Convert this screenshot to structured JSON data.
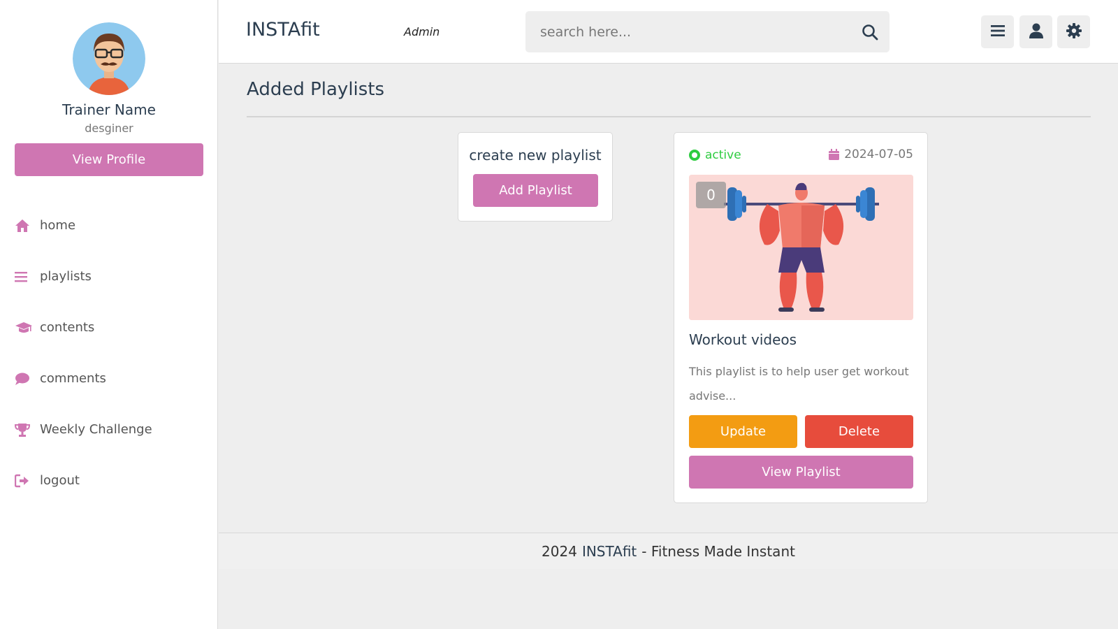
{
  "header": {
    "logo": "INSTAfit",
    "role": "Admin",
    "search_placeholder": "search here..."
  },
  "profile": {
    "name": "Trainer Name",
    "role": "desginer",
    "view_profile_label": "View Profile"
  },
  "nav": {
    "items": [
      {
        "label": "home",
        "icon": "home-icon"
      },
      {
        "label": "playlists",
        "icon": "list-icon"
      },
      {
        "label": "contents",
        "icon": "graduation-cap-icon"
      },
      {
        "label": "comments",
        "icon": "comment-icon"
      },
      {
        "label": "Weekly Challenge",
        "icon": "trophy-icon"
      },
      {
        "label": "logout",
        "icon": "logout-icon"
      }
    ]
  },
  "main": {
    "title": "Added Playlists",
    "create_card": {
      "title": "create new playlist",
      "button_label": "Add Playlist"
    },
    "playlist": {
      "status": "active",
      "date": "2024-07-05",
      "count": "0",
      "title": "Workout videos",
      "description": "This playlist is to help user get workout advise...",
      "update_label": "Update",
      "delete_label": "Delete",
      "view_label": "View Playlist"
    }
  },
  "footer": {
    "year": "2024",
    "brand": "INSTAfit",
    "tagline": "- Fitness Made Instant"
  },
  "colors": {
    "accent": "#cf76b2",
    "update": "#f39c12",
    "delete": "#e74c3c",
    "active": "#2ecc40"
  }
}
